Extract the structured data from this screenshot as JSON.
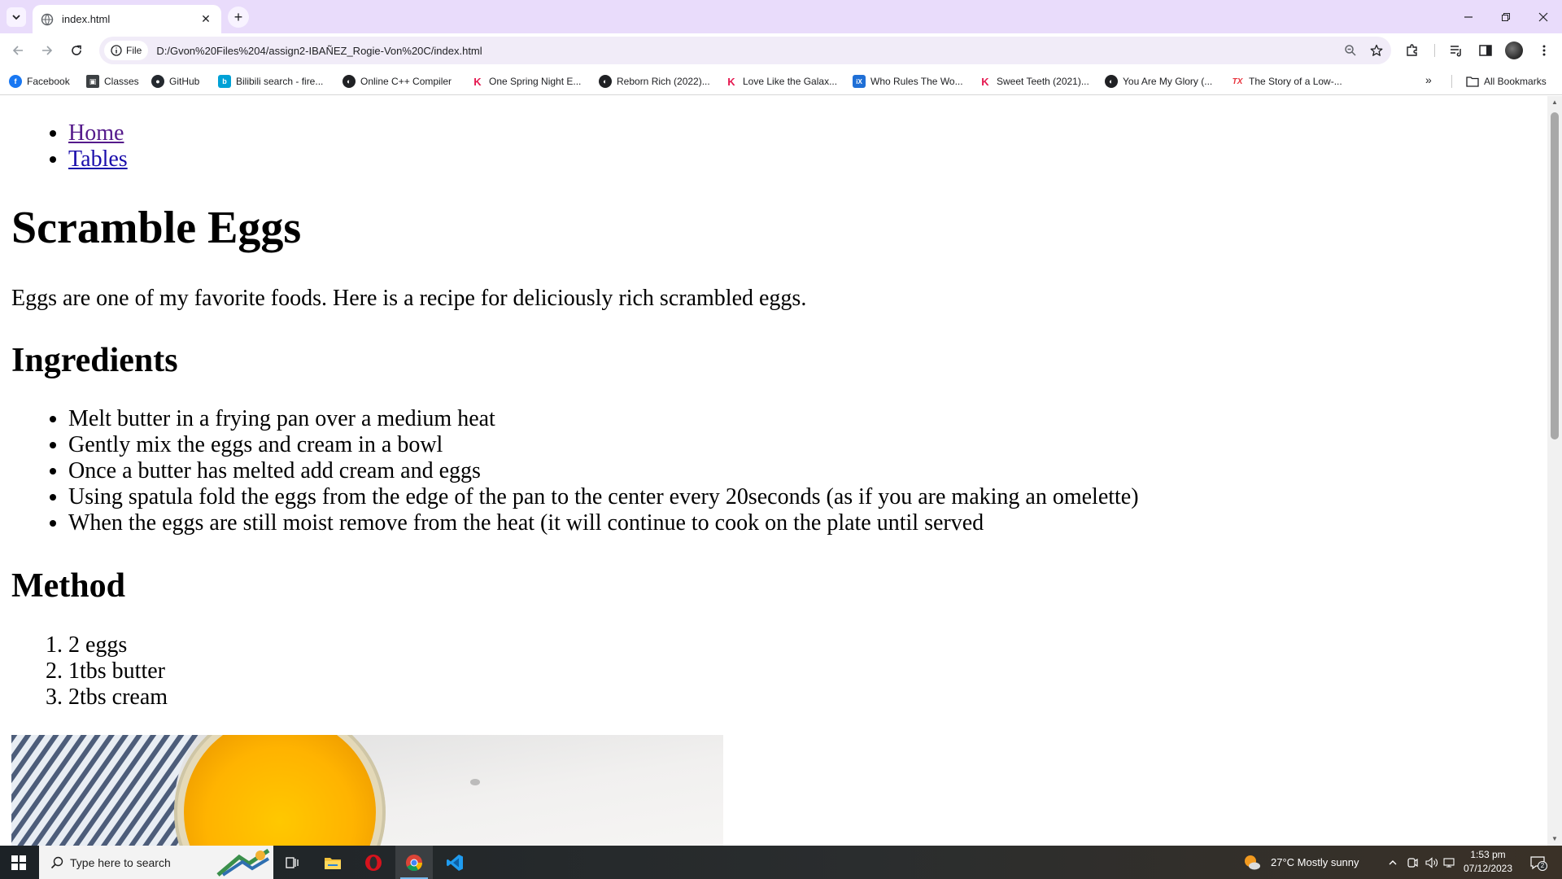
{
  "browser": {
    "tab_title": "index.html",
    "new_tab_label": "+",
    "site_chip": "File",
    "url": "D:/Gvon%20Files%204/assign2-IBAÑEZ_Rogie-Von%20C/index.html",
    "tab_close": "✕"
  },
  "bookmarks": [
    {
      "label": "Facebook",
      "icon": "facebook-icon",
      "color": "#1877f2",
      "glyph": "f"
    },
    {
      "label": "Classes",
      "icon": "classroom-icon",
      "color": "#3c4043",
      "glyph": "▣"
    },
    {
      "label": "GitHub",
      "icon": "github-icon",
      "color": "#24292f",
      "glyph": "●"
    },
    {
      "label": "Bilibili search - fire...",
      "icon": "bilibili-icon",
      "color": "#00a1d6",
      "glyph": "b"
    },
    {
      "label": "Online C++ Compiler",
      "icon": "globe-icon",
      "color": "#202124",
      "glyph": "◐"
    },
    {
      "label": "One Spring Night E...",
      "icon": "kocowa-icon",
      "color": "#e5174f",
      "glyph": "K"
    },
    {
      "label": "Reborn Rich (2022)...",
      "icon": "globe-icon",
      "color": "#202124",
      "glyph": "◐"
    },
    {
      "label": "Love Like the Galax...",
      "icon": "kocowa-icon",
      "color": "#e5174f",
      "glyph": "K"
    },
    {
      "label": "Who Rules The Wo...",
      "icon": "iqiyi-icon",
      "color": "#1f6fd6",
      "glyph": "iX"
    },
    {
      "label": "Sweet Teeth (2021)...",
      "icon": "kocowa-icon",
      "color": "#e5174f",
      "glyph": "K"
    },
    {
      "label": "You Are My Glory (...",
      "icon": "globe-icon",
      "color": "#202124",
      "glyph": "◐"
    },
    {
      "label": "The Story of a Low-...",
      "icon": "wetv-icon",
      "color": "#e8323c",
      "glyph": "TX"
    }
  ],
  "bookmarks_more": "»",
  "all_bookmarks": "All Bookmarks",
  "page": {
    "nav": [
      {
        "label": "Home",
        "visited": true
      },
      {
        "label": "Tables",
        "visited": false
      }
    ],
    "title": "Scramble Eggs",
    "intro": "Eggs are one of my favorite foods. Here is a recipe for deliciously rich scrambled eggs.",
    "ingredients_heading": "Ingredients",
    "ingredients": [
      "Melt butter in a frying pan over a medium heat",
      "Gently mix the eggs and cream in a bowl",
      "Once a butter has melted add cream and eggs",
      "Using spatula fold the eggs from the edge of the pan to the center every 20seconds (as if you are making an omelette)",
      "When the eggs are still moist remove from the heat (it will continue to cook on the plate until served"
    ],
    "method_heading": "Method",
    "method": [
      "2 eggs",
      "1tbs butter",
      "2tbs cream"
    ]
  },
  "taskbar": {
    "search_placeholder": "Type here to search",
    "weather": "27°C  Mostly sunny",
    "time": "1:53 pm",
    "date": "07/12/2023",
    "notifications": "2"
  }
}
